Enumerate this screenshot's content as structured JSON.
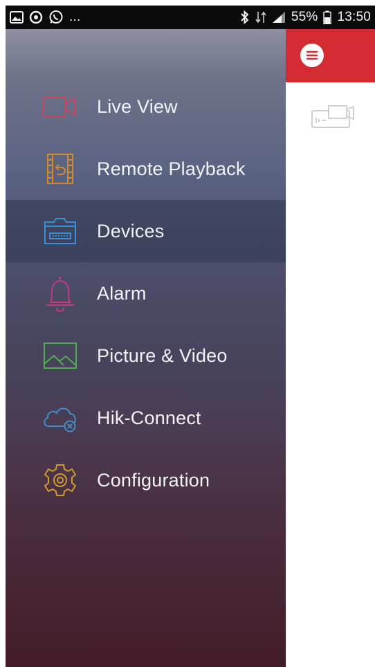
{
  "status_bar": {
    "left_icons": [
      "image-icon",
      "sync-icon",
      "whatsapp-icon"
    ],
    "left_more": "...",
    "right_icons": [
      "bluetooth-icon",
      "data-icon",
      "signal-icon"
    ],
    "battery": "55%",
    "time": "13:50"
  },
  "drawer": {
    "items": [
      {
        "label": "Live View",
        "icon": "video-camera-icon",
        "color": "#d0435a",
        "selected": false
      },
      {
        "label": "Remote Playback",
        "icon": "film-playback-icon",
        "color": "#d18a2e",
        "selected": false
      },
      {
        "label": "Devices",
        "icon": "dvr-device-icon",
        "color": "#3b8fd6",
        "selected": true
      },
      {
        "label": "Alarm",
        "icon": "bell-icon",
        "color": "#c8397e",
        "selected": false
      },
      {
        "label": "Picture & Video",
        "icon": "picture-icon",
        "color": "#4caf50",
        "selected": false
      },
      {
        "label": "Hik-Connect",
        "icon": "cloud-icon",
        "color": "#3f8fc8",
        "selected": false
      },
      {
        "label": "Configuration",
        "icon": "gear-icon",
        "color": "#d39a2e",
        "selected": false
      }
    ]
  },
  "header": {
    "accent_color": "#d42a31",
    "menu_icon": "hamburger-icon"
  },
  "content": {
    "device_icon": "dvr-device-icon"
  }
}
